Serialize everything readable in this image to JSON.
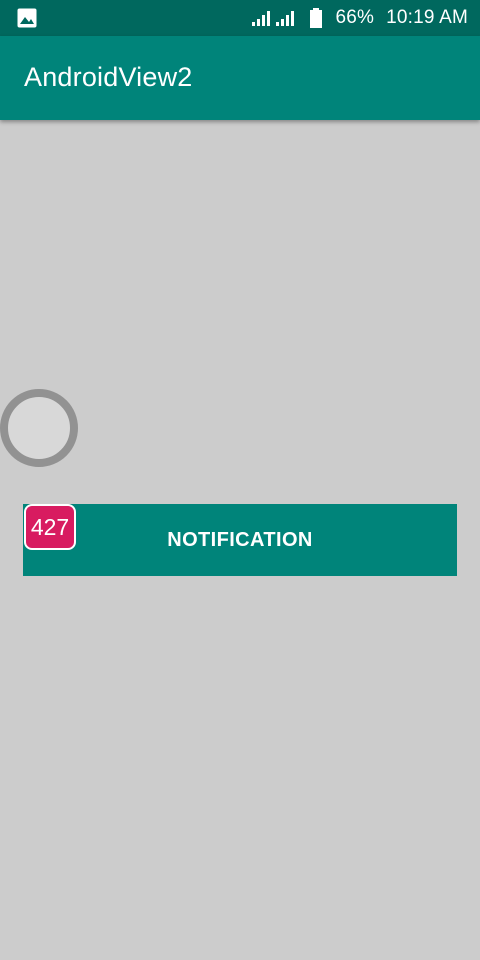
{
  "status_bar": {
    "image_icon": "image-icon",
    "signal_icons": [
      "signal-icon",
      "signal-icon"
    ],
    "battery_icon": "battery-icon",
    "battery_percent": "66%",
    "time": "10:19 AM"
  },
  "app_bar": {
    "title": "AndroidView2",
    "color": "#00847a"
  },
  "main": {
    "circle_widget": "circle-icon",
    "notification_button": {
      "label": "NOTIFICATION",
      "badge_count": "427",
      "badge_color": "#d81b60"
    }
  }
}
